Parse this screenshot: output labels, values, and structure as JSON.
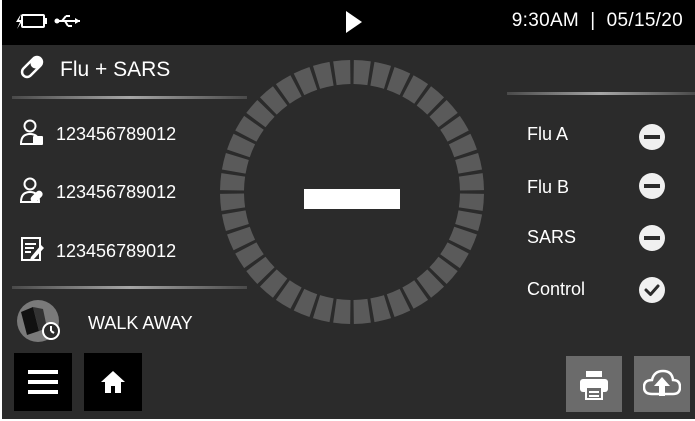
{
  "status_bar": {
    "time": "9:30AM",
    "date": "05/15/20",
    "icons": [
      "battery-charging-icon",
      "usb-icon",
      "play-icon"
    ]
  },
  "test": {
    "name": "Flu + SARS",
    "icon": "test-strip-icon"
  },
  "ids": [
    {
      "icon": "patient-icon",
      "value": "123456789012"
    },
    {
      "icon": "operator-icon",
      "value": "123456789012"
    },
    {
      "icon": "notes-icon",
      "value": "123456789012"
    }
  ],
  "walk_away": {
    "label": "WALK AWAY",
    "icon": "device-timer-icon"
  },
  "progress": {
    "indicator": "dash",
    "segments": 40
  },
  "results": [
    {
      "label": "Flu A",
      "status": "negative",
      "icon": "minus-icon"
    },
    {
      "label": "Flu B",
      "status": "negative",
      "icon": "minus-icon"
    },
    {
      "label": "SARS",
      "status": "negative",
      "icon": "minus-icon"
    },
    {
      "label": "Control",
      "status": "valid",
      "icon": "check-icon"
    }
  ],
  "toolbar": {
    "menu_icon": "menu-icon",
    "home_icon": "home-icon",
    "print_icon": "printer-icon",
    "upload_icon": "cloud-upload-icon"
  },
  "colors": {
    "background": "#2b2b2b",
    "status_bar": "#000000",
    "ring_segment": "#5a5a5a",
    "text": "#ffffff",
    "button_dark": "#000000",
    "button_gray": "#6b6b6b"
  }
}
